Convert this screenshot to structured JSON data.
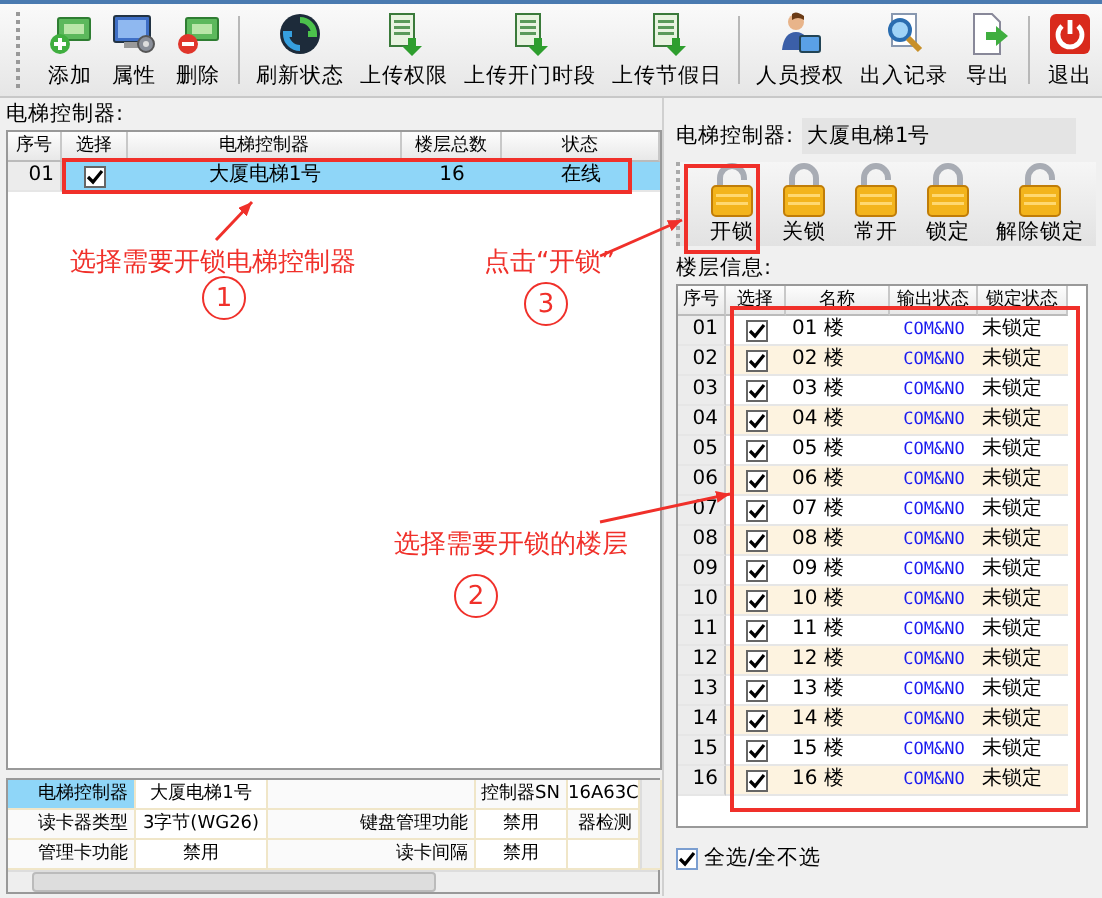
{
  "toolbar_groups": [
    {
      "buttons": [
        {
          "label": "添加"
        },
        {
          "label": "属性"
        },
        {
          "label": "删除"
        }
      ]
    },
    {
      "buttons": [
        {
          "label": "刷新状态"
        },
        {
          "label": "上传权限"
        },
        {
          "label": "上传开门时段"
        },
        {
          "label": "上传节假日"
        }
      ]
    },
    {
      "buttons": [
        {
          "label": "人员授权"
        },
        {
          "label": "出入记录"
        },
        {
          "label": "导出"
        }
      ]
    },
    {
      "buttons": [
        {
          "label": "退出"
        }
      ]
    }
  ],
  "controllers": {
    "title": "电梯控制器:",
    "columns": [
      "序号",
      "选择",
      "电梯控制器",
      "楼层总数",
      "状态"
    ],
    "rows": [
      {
        "no": "01",
        "checked": true,
        "selected": true,
        "name": "大厦电梯1号",
        "floors": "16",
        "status": "在线"
      }
    ]
  },
  "details": {
    "rows": [
      {
        "selected": true,
        "cells": [
          {
            "text": "电梯控制器",
            "kind": "label"
          },
          {
            "text": "大厦电梯1号",
            "kind": "value"
          },
          {
            "text": "",
            "kind": "label"
          },
          {
            "text": "控制器SN",
            "kind": "label"
          },
          {
            "text": "16A63C",
            "kind": "value"
          }
        ]
      },
      {
        "selected": false,
        "cells": [
          {
            "text": "读卡器类型",
            "kind": "label"
          },
          {
            "text": "3字节(WG26)",
            "kind": "value"
          },
          {
            "text": "键盘管理功能",
            "kind": "label"
          },
          {
            "text": "禁用",
            "kind": "value"
          },
          {
            "text": "器检测",
            "kind": "label"
          }
        ]
      },
      {
        "selected": false,
        "cells": [
          {
            "text": "管理卡功能",
            "kind": "label"
          },
          {
            "text": "禁用",
            "kind": "value"
          },
          {
            "text": "读卡间隔",
            "kind": "label"
          },
          {
            "text": "禁用",
            "kind": "value"
          },
          {
            "text": "",
            "kind": "value"
          }
        ]
      }
    ]
  },
  "controller_field": {
    "label": "电梯控制器:",
    "value": "大厦电梯1号"
  },
  "lock_buttons": [
    {
      "label": "开锁"
    },
    {
      "label": "关锁"
    },
    {
      "label": "常开"
    },
    {
      "label": "锁定"
    },
    {
      "label": "解除锁定"
    }
  ],
  "floors": {
    "title": "楼层信息:",
    "columns": [
      "序号",
      "选择",
      "名称",
      "输出状态",
      "锁定状态"
    ],
    "rows": [
      {
        "no": "01",
        "checked": true,
        "name": "01 楼",
        "output": "COM&NO",
        "lock": "未锁定"
      },
      {
        "no": "02",
        "checked": true,
        "name": "02 楼",
        "output": "COM&NO",
        "lock": "未锁定"
      },
      {
        "no": "03",
        "checked": true,
        "name": "03 楼",
        "output": "COM&NO",
        "lock": "未锁定"
      },
      {
        "no": "04",
        "checked": true,
        "name": "04 楼",
        "output": "COM&NO",
        "lock": "未锁定"
      },
      {
        "no": "05",
        "checked": true,
        "name": "05 楼",
        "output": "COM&NO",
        "lock": "未锁定"
      },
      {
        "no": "06",
        "checked": true,
        "name": "06 楼",
        "output": "COM&NO",
        "lock": "未锁定"
      },
      {
        "no": "07",
        "checked": true,
        "name": "07 楼",
        "output": "COM&NO",
        "lock": "未锁定"
      },
      {
        "no": "08",
        "checked": true,
        "name": "08 楼",
        "output": "COM&NO",
        "lock": "未锁定"
      },
      {
        "no": "09",
        "checked": true,
        "name": "09 楼",
        "output": "COM&NO",
        "lock": "未锁定"
      },
      {
        "no": "10",
        "checked": true,
        "name": "10 楼",
        "output": "COM&NO",
        "lock": "未锁定"
      },
      {
        "no": "11",
        "checked": true,
        "name": "11 楼",
        "output": "COM&NO",
        "lock": "未锁定"
      },
      {
        "no": "12",
        "checked": true,
        "name": "12 楼",
        "output": "COM&NO",
        "lock": "未锁定"
      },
      {
        "no": "13",
        "checked": true,
        "name": "13 楼",
        "output": "COM&NO",
        "lock": "未锁定"
      },
      {
        "no": "14",
        "checked": true,
        "name": "14 楼",
        "output": "COM&NO",
        "lock": "未锁定"
      },
      {
        "no": "15",
        "checked": true,
        "name": "15 楼",
        "output": "COM&NO",
        "lock": "未锁定"
      },
      {
        "no": "16",
        "checked": true,
        "name": "16 楼",
        "output": "COM&NO",
        "lock": "未锁定"
      }
    ],
    "select_all": {
      "label": "全选/全不选",
      "checked": true
    }
  },
  "callouts": [
    {
      "text": "选择需要开锁电梯控制器",
      "number": "1"
    },
    {
      "text": "点击“开锁”",
      "number": "3"
    },
    {
      "text": "选择需要开锁的楼层",
      "number": "2"
    }
  ]
}
